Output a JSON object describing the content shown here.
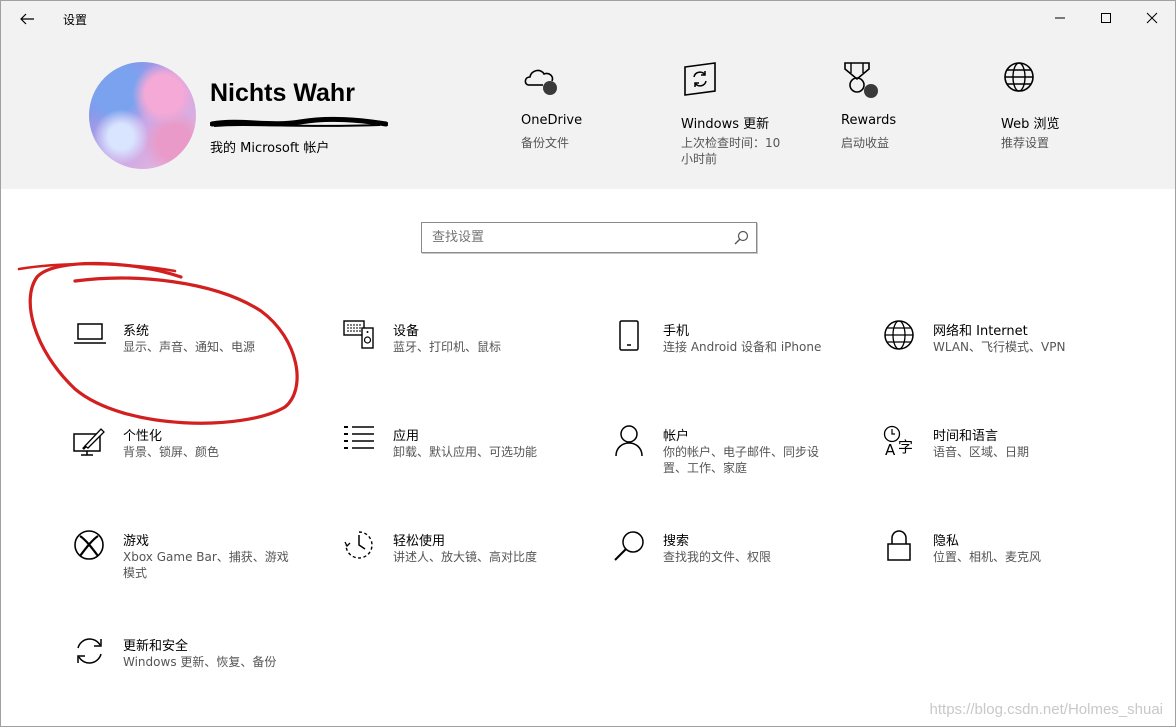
{
  "window": {
    "title": "设置",
    "controls": {
      "back": "back-arrow-icon",
      "minimize": "minimize-icon",
      "maximize": "maximize-icon",
      "close": "close-icon"
    }
  },
  "profile": {
    "name": "Nichts Wahr",
    "account_link": "我的 Microsoft 帐户"
  },
  "quick_links": [
    {
      "title": "OneDrive",
      "subtitle": "备份文件",
      "icon": "onedrive-cloud-icon"
    },
    {
      "title": "Windows 更新",
      "subtitle": "上次检查时间：10 小时前",
      "icon": "windows-update-icon"
    },
    {
      "title": "Rewards",
      "subtitle": "启动收益",
      "icon": "rewards-medal-icon"
    },
    {
      "title": "Web 浏览",
      "subtitle": "推荐设置",
      "icon": "globe-icon"
    }
  ],
  "search": {
    "placeholder": "查找设置"
  },
  "categories": [
    {
      "title": "系统",
      "subtitle": "显示、声音、通知、电源",
      "icon": "laptop-icon"
    },
    {
      "title": "设备",
      "subtitle": "蓝牙、打印机、鼠标",
      "icon": "devices-icon"
    },
    {
      "title": "手机",
      "subtitle": "连接 Android 设备和 iPhone",
      "icon": "phone-icon"
    },
    {
      "title": "网络和 Internet",
      "subtitle": "WLAN、飞行模式、VPN",
      "icon": "globe-icon"
    },
    {
      "title": "个性化",
      "subtitle": "背景、锁屏、颜色",
      "icon": "personalization-icon"
    },
    {
      "title": "应用",
      "subtitle": "卸载、默认应用、可选功能",
      "icon": "apps-list-icon"
    },
    {
      "title": "帐户",
      "subtitle": "你的帐户、电子邮件、同步设置、工作、家庭",
      "icon": "person-icon"
    },
    {
      "title": "时间和语言",
      "subtitle": "语音、区域、日期",
      "icon": "time-language-icon"
    },
    {
      "title": "游戏",
      "subtitle": "Xbox Game Bar、捕获、游戏模式",
      "icon": "xbox-icon"
    },
    {
      "title": "轻松使用",
      "subtitle": "讲述人、放大镜、高对比度",
      "icon": "ease-of-access-icon"
    },
    {
      "title": "搜索",
      "subtitle": "查找我的文件、权限",
      "icon": "search-icon"
    },
    {
      "title": "隐私",
      "subtitle": "位置、相机、麦克风",
      "icon": "lock-icon"
    },
    {
      "title": "更新和安全",
      "subtitle": "Windows 更新、恢复、备份",
      "icon": "sync-icon"
    }
  ],
  "watermark": "https://blog.csdn.net/Holmes_shuai",
  "colors": {
    "header_bg": "#f2f2f2",
    "annotation_red": "#d21f1f",
    "text_secondary": "#555555"
  }
}
